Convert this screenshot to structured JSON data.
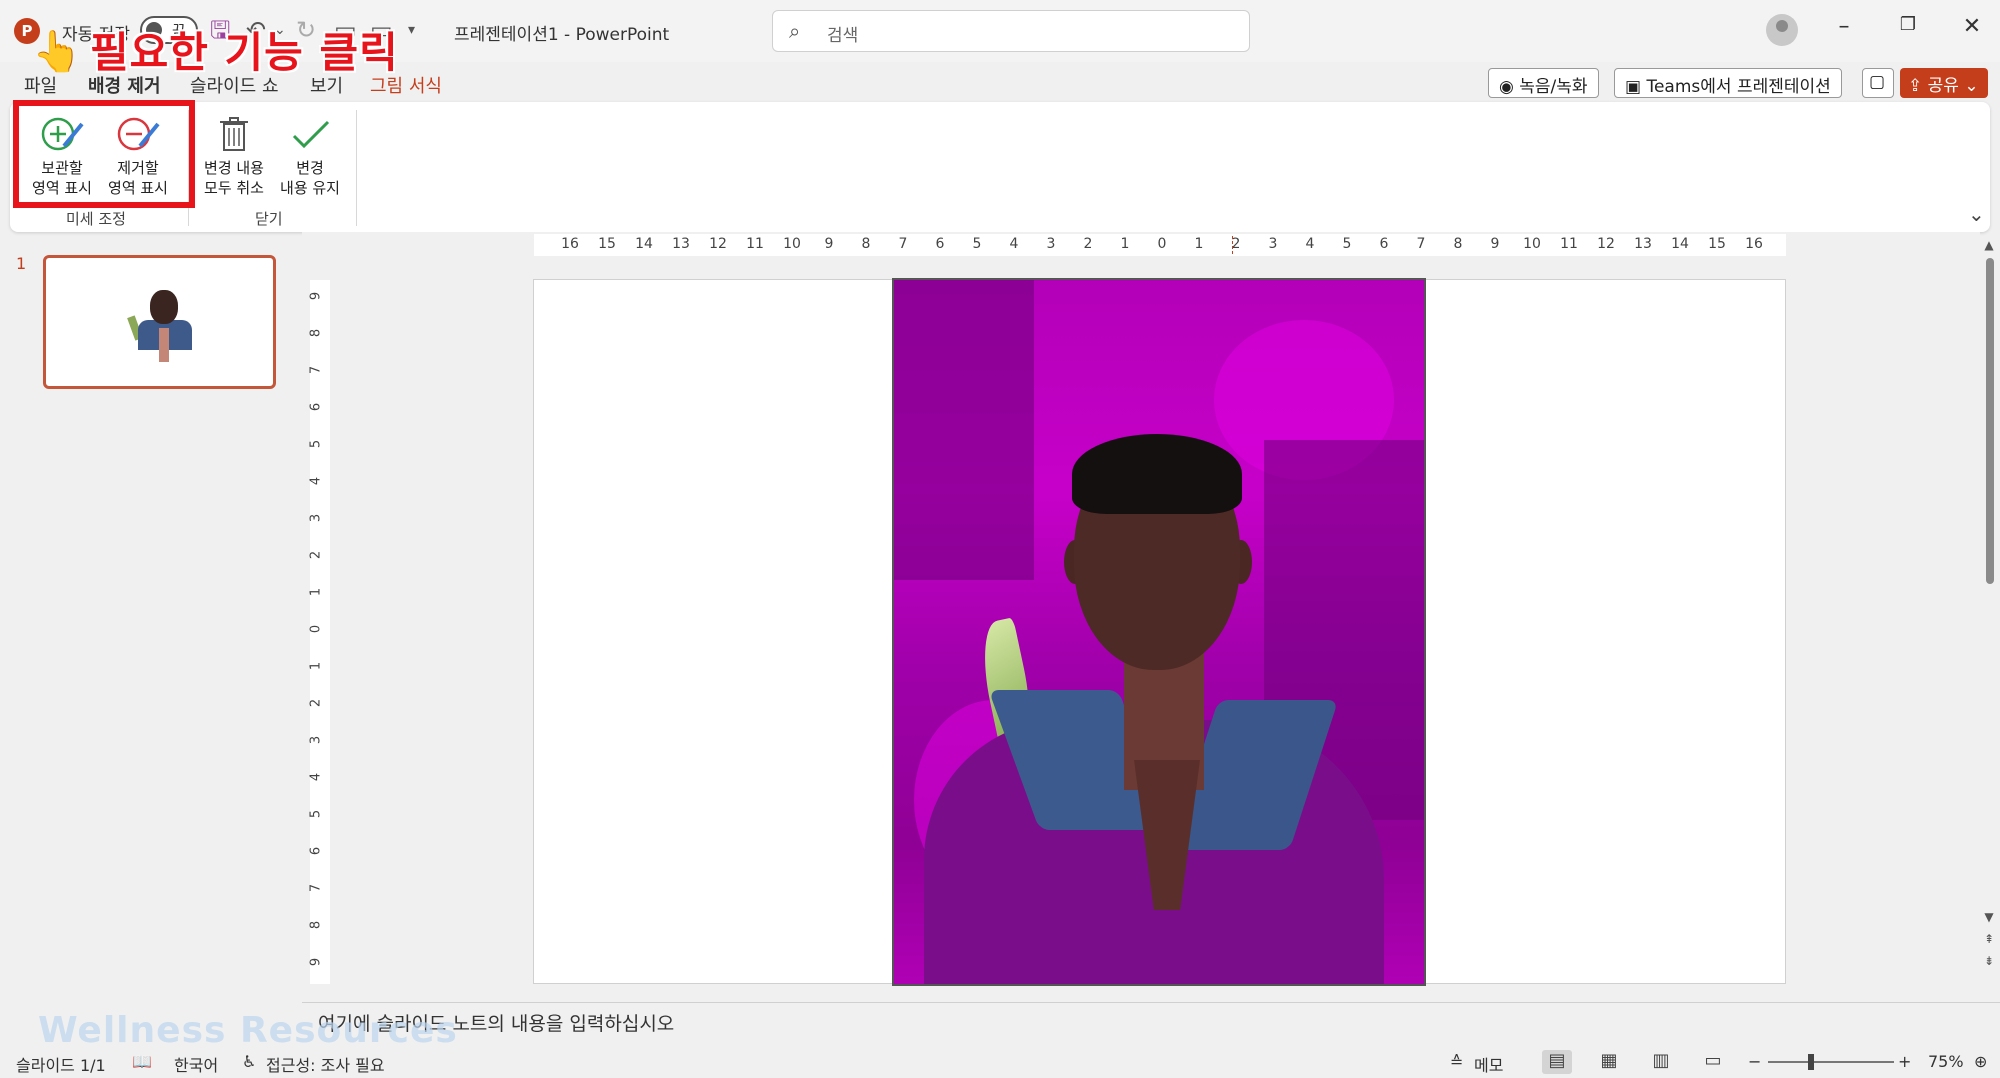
{
  "titlebar": {
    "app_logo": "P",
    "autosave_label": "자동 저장",
    "autosave_state": "끔",
    "doc_title": "프레젠테이션1  -  PowerPoint",
    "search_placeholder": "검색",
    "qat_icons": [
      "save-icon",
      "undo-icon",
      "redo-icon",
      "present-from-start-icon",
      "present-icon",
      "customize-icon"
    ]
  },
  "annotation": {
    "text": "필요한 기능 클릭",
    "color": "#e8141c"
  },
  "tabs": [
    {
      "label": "파일"
    },
    {
      "label": "배경 제거",
      "active": true
    },
    {
      "label": "슬라이드 쇼"
    },
    {
      "label": "보기"
    },
    {
      "label": "그림 서식",
      "contextual": true
    }
  ],
  "right_buttons": {
    "record": "녹음/녹화",
    "teams": "Teams에서 프레젠테이션",
    "share": "공유"
  },
  "ribbon": {
    "buttons": [
      {
        "label": "보관할\n영역 표시",
        "icon": "mark-keep-icon"
      },
      {
        "label": "제거할\n영역 표시",
        "icon": "mark-remove-icon"
      },
      {
        "label": "변경 내용\n모두 취소",
        "icon": "discard-all-icon"
      },
      {
        "label": "변경\n내용 유지",
        "icon": "keep-changes-icon"
      }
    ],
    "groups": [
      {
        "label": "미세 조정"
      },
      {
        "label": "닫기"
      }
    ]
  },
  "thumbnails": [
    {
      "number": "1"
    }
  ],
  "ruler": {
    "horizontal": [
      "16",
      "15",
      "14",
      "13",
      "12",
      "11",
      "10",
      "9",
      "8",
      "7",
      "6",
      "5",
      "4",
      "3",
      "2",
      "1",
      "0",
      "1",
      "2",
      "3",
      "4",
      "5",
      "6",
      "7",
      "8",
      "9",
      "10",
      "11",
      "12",
      "13",
      "14",
      "15",
      "16"
    ],
    "vertical": [
      "9",
      "8",
      "7",
      "6",
      "5",
      "4",
      "3",
      "2",
      "1",
      "0",
      "1",
      "2",
      "3",
      "4",
      "5",
      "6",
      "7",
      "8",
      "9"
    ]
  },
  "notes": {
    "placeholder": "여기에 슬라이드 노트의 내용을 입력하십시오"
  },
  "watermark": "Wellness Resources",
  "statusbar": {
    "slide": "슬라이드 1/1",
    "language": "한국어",
    "accessibility": "접근성: 조사 필요",
    "notes": "메모",
    "zoom": "75%"
  },
  "colors": {
    "accent": "#c43e1c",
    "removal_mask": "#b300b8"
  }
}
